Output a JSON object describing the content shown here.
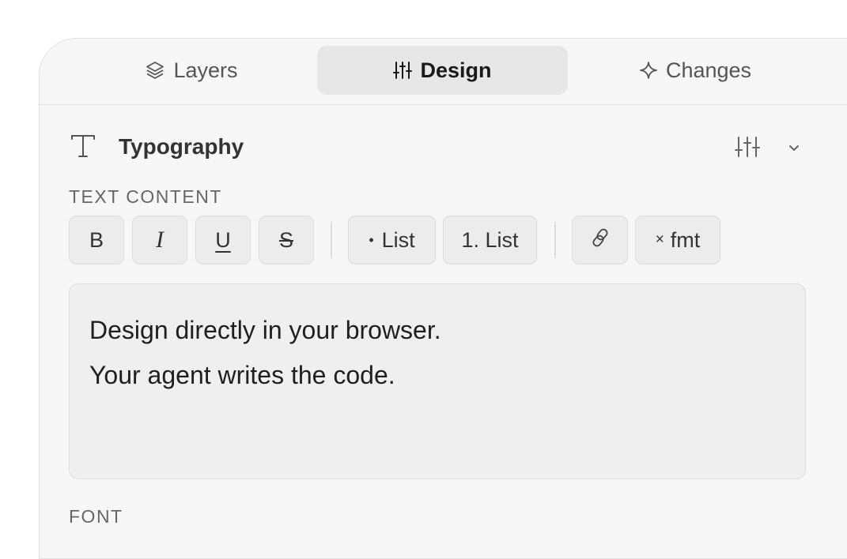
{
  "tabs": {
    "layers": {
      "label": "Layers",
      "icon": "layers-icon"
    },
    "design": {
      "label": "Design",
      "icon": "sliders-icon",
      "active": true
    },
    "changes": {
      "label": "Changes",
      "icon": "sparkle-icon"
    }
  },
  "section": {
    "title": "Typography",
    "icon": "type-icon",
    "actions": [
      "sliders-icon",
      "chevron-down-icon"
    ]
  },
  "text_content": {
    "label": "TEXT CONTENT",
    "toolbar": {
      "bold": "B",
      "italic": "I",
      "underline": "U",
      "strikethrough": "S",
      "bullet_list": "List",
      "numbered_list": "1. List",
      "link_icon": "link-icon",
      "clear_format": "fmt"
    },
    "lines": [
      "Design directly in your browser.",
      "Your agent writes the code."
    ]
  },
  "font": {
    "label": "FONT"
  },
  "colors": {
    "panel_bg": "#f7f7f7",
    "active_tab_bg": "#e7e7e7",
    "button_bg": "#ececec",
    "editor_bg": "#efefef"
  }
}
